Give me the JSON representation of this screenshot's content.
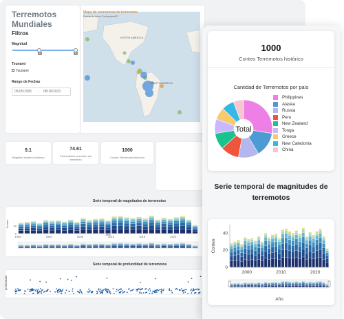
{
  "dashboard": {
    "title": "Terremotos Mundiales",
    "filters_heading": "Filtros",
    "magnitude_label": "Magnitud",
    "magnitude_range": [
      "0",
      "8"
    ],
    "tsunami_heading": "Tsunami",
    "tsunami_checkbox": "Tsunami",
    "date_heading": "Rango de Fechas",
    "date_start": "05/05/1995",
    "date_end": "08/16/2023",
    "map_title": "Mapa de ocurrencias de terremotos",
    "map_source": "Fuente de datos: EarthquakeAPI",
    "map_labels": [
      "NORTH AMERICA",
      "SOUTH AMERICA"
    ],
    "kpis": [
      {
        "value": "9.1",
        "label": "Magnitud máximo histórico"
      },
      {
        "value": "74.61",
        "label": "Profundidad promedio del terremoto"
      },
      {
        "value": "1000",
        "label": "Conteo Terremotos histórico"
      }
    ],
    "ts_mag_title": "Serie temporal de magnitudes de terremotos",
    "ts_depth_title": "Serie temporal de profundidad de terremotos",
    "ts_depth_ylabel": "profundidad",
    "small_x_ticks": [
      "1995",
      "2000",
      "2005",
      "2010",
      "2015",
      "2020"
    ],
    "small_y_ticks_mag": [
      "20",
      "0"
    ]
  },
  "front": {
    "count_value": "1000",
    "count_label": "Conteo Terremotos histórico",
    "pie_title": "Cantidad de Terremotos por país",
    "pie_center": "Total",
    "ts_title": "Serie temporal de magnitudes de terremotos",
    "ts_ylabel": "Conteo",
    "ts_xlabel": "Año"
  },
  "colors": {
    "accent": "#d8751f",
    "bar_palette": [
      "#1b2f6b",
      "#204a8a",
      "#2a6aa6",
      "#3f8fbf",
      "#6db4cf",
      "#a5d6c6",
      "#e2d97a"
    ]
  },
  "chart_data": [
    {
      "type": "pie",
      "title": "Cantidad de Terremotos por país",
      "categories": [
        "Philippines",
        "Alaska",
        "Russia",
        "Peru",
        "New Zealand",
        "Tonga",
        "Greece",
        "New Caledonia",
        "China"
      ],
      "values": [
        24,
        12,
        10,
        9,
        8,
        7,
        6,
        6,
        5
      ],
      "legend_colors": [
        "#ee7fe6",
        "#4d9bd4",
        "#b3b6ef",
        "#ef553b",
        "#1ac38d",
        "#c9b8ff",
        "#f7ca6f",
        "#33b8e8",
        "#f8c6cf"
      ],
      "legend": "right"
    },
    {
      "type": "bar",
      "title": "Serie temporal de magnitudes de terremotos",
      "xlabel": "Año",
      "ylabel": "Conteo",
      "x": [
        1995,
        1996,
        1997,
        1998,
        1999,
        2000,
        2001,
        2002,
        2003,
        2004,
        2005,
        2006,
        2007,
        2008,
        2009,
        2010,
        2011,
        2012,
        2013,
        2014,
        2015,
        2016,
        2017,
        2018,
        2019,
        2020,
        2021,
        2022,
        2023
      ],
      "values": [
        28,
        30,
        32,
        27,
        35,
        33,
        34,
        31,
        36,
        30,
        40,
        35,
        38,
        39,
        34,
        44,
        45,
        42,
        40,
        43,
        39,
        46,
        36,
        41,
        38,
        42,
        45,
        36,
        22
      ],
      "x_ticks": [
        "2000",
        "2010",
        "2020"
      ],
      "y_ticks": [
        "0",
        "20",
        "40"
      ],
      "ylim": [
        0,
        50
      ]
    }
  ]
}
